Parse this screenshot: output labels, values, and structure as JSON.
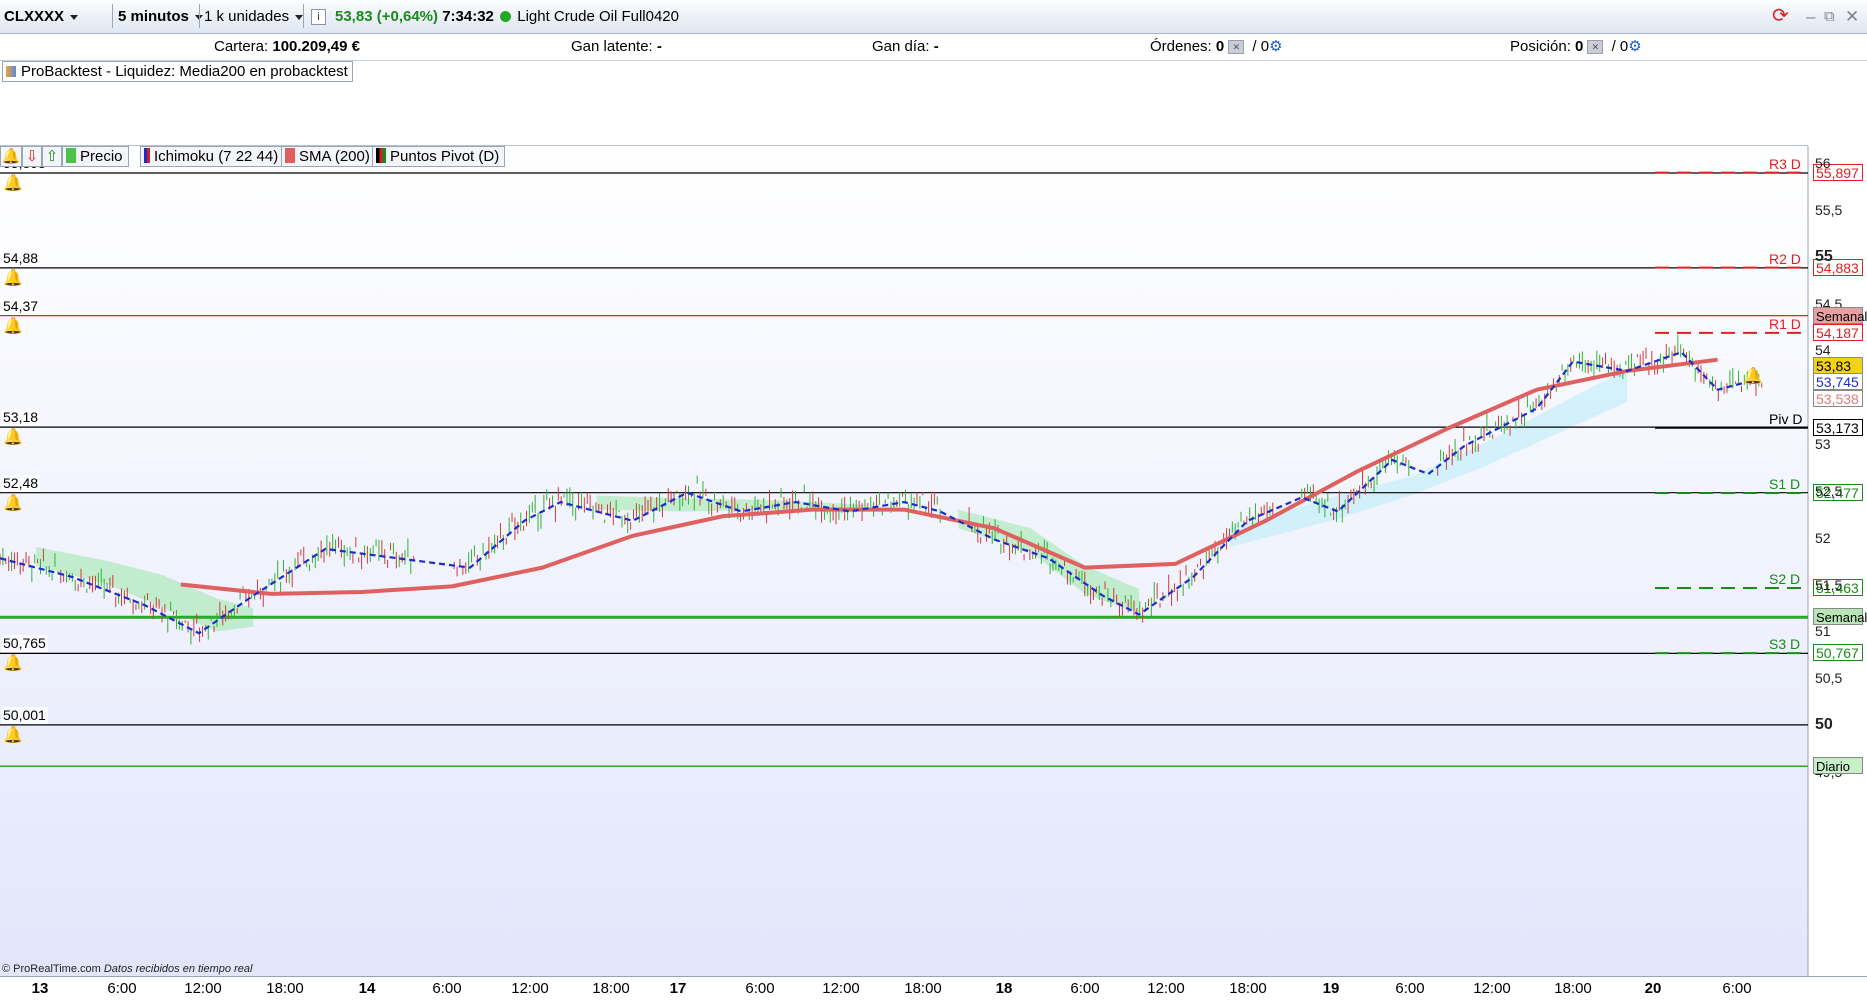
{
  "toolbar": {
    "symbol": "CLXXXX",
    "timeframe": "5 minutos",
    "units": "1 k unidades",
    "info_icon": "info-icon",
    "last_price": "53,83",
    "change": "(+0,64%)",
    "time": "7:34:32",
    "instrument": "Light Crude Oil Full0420",
    "status_color": "#22aa22"
  },
  "info": {
    "cartera_label": "Cartera:",
    "cartera_value": "100.209,49 €",
    "gan_latente_label": "Gan latente:",
    "gan_latente_value": "-",
    "gan_dia_label": "Gan día:",
    "gan_dia_value": "-",
    "ordenes_label": "Órdenes:",
    "ordenes_value": "0",
    "ordenes_sep": "/ 0",
    "posicion_label": "Posición:",
    "posicion_value": "0",
    "posicion_sep": "/ 0"
  },
  "probacktest": {
    "label": "ProBacktest - Liquidez: Media200 en probacktest"
  },
  "legend": {
    "precio": "Precio",
    "ichimoku": "Ichimoku (7 22 44)",
    "sma": "SMA (200)",
    "pivots": "Puntos Pivot (D)"
  },
  "price_lines": [
    {
      "label": "55,893",
      "value": 55.893,
      "color": "#000000"
    },
    {
      "label": "54,88",
      "value": 54.88,
      "color": "#000000"
    },
    {
      "label": "54,37",
      "value": 54.37,
      "color": "#d01010"
    },
    {
      "label": "53,18",
      "value": 53.18,
      "color": "#000000"
    },
    {
      "label": "52,48",
      "value": 52.48,
      "color": "#000000"
    },
    {
      "label": "50,765",
      "value": 50.765,
      "color": "#000000"
    },
    {
      "label": "50,001",
      "value": 50.001,
      "color": "#000000"
    }
  ],
  "pivots": [
    {
      "name": "R3 D",
      "value": 55.897,
      "tag": "55,897",
      "color": "#e02020",
      "style": "dash"
    },
    {
      "name": "R2 D",
      "value": 54.883,
      "tag": "54,883",
      "color": "#e02020",
      "style": "dash"
    },
    {
      "name": "R1 D",
      "value": 54.187,
      "tag": "54,187",
      "color": "#e02020",
      "style": "dash"
    },
    {
      "name": "Piv D",
      "value": 53.173,
      "tag": "53,173",
      "color": "#000000",
      "style": "solid"
    },
    {
      "name": "S1 D",
      "value": 52.477,
      "tag": "52,477",
      "color": "#1a8a1a",
      "style": "dash"
    },
    {
      "name": "S2 D",
      "value": 51.463,
      "tag": "51,463",
      "color": "#1a8a1a",
      "style": "dash"
    },
    {
      "name": "S3 D",
      "value": 50.767,
      "tag": "50,767",
      "color": "#1a8a1a",
      "style": "dash"
    }
  ],
  "level_tags": [
    {
      "label": "Semanal",
      "value": 54.37,
      "bg": "#e8a0a0"
    },
    {
      "label": "Semanal",
      "value": 51.15,
      "bg": "#b8e6b8"
    },
    {
      "label": "Diario",
      "value": 49.56,
      "bg": "#c8efc8"
    }
  ],
  "price_tags": [
    {
      "label": "53,83",
      "value": 53.83,
      "bg": "#f3d21a",
      "fg": "#000000"
    },
    {
      "label": "53,745",
      "value": 53.66,
      "bg": "#ffffff",
      "fg": "#1a2fc9"
    },
    {
      "label": "53,538",
      "value": 53.48,
      "bg": "#ffffff",
      "fg": "#e07a7a"
    }
  ],
  "axis": {
    "ticks": [
      "56",
      "55,5",
      "55",
      "54,5",
      "54",
      "53,5",
      "53",
      "52,5",
      "52",
      "51,5",
      "51",
      "50,5",
      "50",
      "49,5"
    ],
    "tick_values": [
      56,
      55.5,
      55,
      54.5,
      54,
      53.5,
      53,
      52.5,
      52,
      51.5,
      51,
      50.5,
      50,
      49.5
    ],
    "bold_ticks": [
      "55",
      "50"
    ]
  },
  "time_labels": [
    {
      "t": "13",
      "bold": true
    },
    {
      "t": "6:00"
    },
    {
      "t": "12:00"
    },
    {
      "t": "18:00"
    },
    {
      "t": "14",
      "bold": true
    },
    {
      "t": "6:00"
    },
    {
      "t": "12:00"
    },
    {
      "t": "18:00"
    },
    {
      "t": "17",
      "bold": true
    },
    {
      "t": "6:00"
    },
    {
      "t": "12:00"
    },
    {
      "t": "18:00"
    },
    {
      "t": "18",
      "bold": true
    },
    {
      "t": "6:00"
    },
    {
      "t": "12:00"
    },
    {
      "t": "18:00"
    },
    {
      "t": "19",
      "bold": true
    },
    {
      "t": "6:00"
    },
    {
      "t": "12:00"
    },
    {
      "t": "18:00"
    },
    {
      "t": "20",
      "bold": true
    },
    {
      "t": "6:00"
    }
  ],
  "footer": {
    "brand": "© ProRealTime.com",
    "note": "Datos recibidos en tiempo real"
  },
  "chart_data": {
    "type": "line",
    "series": [
      {
        "color": "#e06060",
        "x": [
          0.1,
          0.15,
          0.2,
          0.25,
          0.3,
          0.35,
          0.4,
          0.45,
          0.5,
          0.55,
          0.6,
          0.65,
          0.7,
          0.75,
          0.8,
          0.85,
          0.9,
          0.95
        ],
        "values": [
          51.5,
          51.4,
          51.42,
          51.48,
          51.68,
          52.02,
          52.23,
          52.3,
          52.3,
          52.1,
          51.68,
          51.72,
          52.18,
          52.7,
          53.16,
          53.58,
          53.78,
          53.9
        ]
      },
      {
        "color": "#1a2fc9",
        "x": [
          0.0,
          0.04,
          0.08,
          0.11,
          0.14,
          0.18,
          0.22,
          0.26,
          0.29,
          0.31,
          0.35,
          0.38,
          0.41,
          0.44,
          0.47,
          0.5,
          0.52,
          0.55,
          0.58,
          0.61,
          0.63,
          0.66,
          0.69,
          0.72,
          0.74,
          0.77,
          0.79,
          0.81,
          0.83,
          0.85,
          0.87,
          0.9,
          0.93,
          0.95,
          0.97
        ],
        "values": [
          51.8,
          51.6,
          51.3,
          51.0,
          51.4,
          51.9,
          51.8,
          51.7,
          52.2,
          52.4,
          52.2,
          52.5,
          52.3,
          52.4,
          52.3,
          52.4,
          52.3,
          52.0,
          51.8,
          51.4,
          51.2,
          51.6,
          52.2,
          52.45,
          52.3,
          52.85,
          52.7,
          53.0,
          53.2,
          53.4,
          53.9,
          53.8,
          54.0,
          53.6,
          53.7
        ]
      }
    ],
    "ylim": [
      49.3,
      56.1
    ]
  }
}
